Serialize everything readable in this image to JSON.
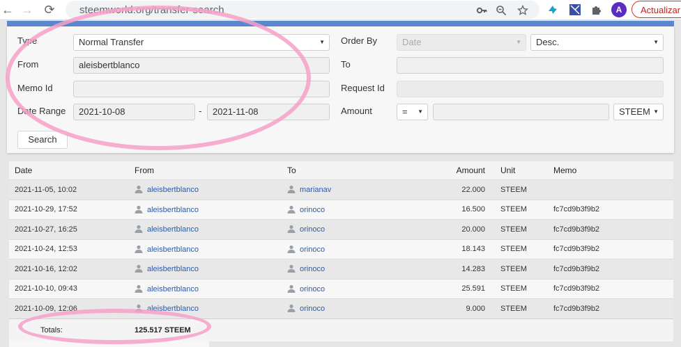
{
  "browser": {
    "url": "steemworld.org/transfer-search",
    "update_label": "Actualizar",
    "avatar_letter": "A",
    "back_glyph": "←",
    "forward_glyph": "→",
    "reload_glyph": "⟳"
  },
  "form": {
    "type_label": "Type",
    "type_value": "Normal Transfer",
    "from_label": "From",
    "from_value": "aleisbertblanco",
    "memo_id_label": "Memo Id",
    "memo_id_value": "",
    "date_range_label": "Date Range",
    "date_from": "2021-10-08",
    "date_separator": "-",
    "date_to": "2021-11-08",
    "order_by_label": "Order By",
    "order_by_value": "Date",
    "order_dir_value": "Desc.",
    "to_label": "To",
    "to_value": "",
    "request_id_label": "Request Id",
    "request_id_value": "",
    "amount_label": "Amount",
    "amount_op_value": "=",
    "amount_value": "",
    "currency_value": "STEEM",
    "search_label": "Search"
  },
  "table": {
    "columns": [
      "Date",
      "From",
      "To",
      "Amount",
      "Unit",
      "Memo"
    ],
    "rows": [
      {
        "date": "2021-11-05, 10:02",
        "from": "aleisbertblanco",
        "to": "marianav",
        "amount": "22.000",
        "unit": "STEEM",
        "memo": ""
      },
      {
        "date": "2021-10-29, 17:52",
        "from": "aleisbertblanco",
        "to": "orinoco",
        "amount": "16.500",
        "unit": "STEEM",
        "memo": "fc7cd9b3f9b2"
      },
      {
        "date": "2021-10-27, 16:25",
        "from": "aleisbertblanco",
        "to": "orinoco",
        "amount": "20.000",
        "unit": "STEEM",
        "memo": "fc7cd9b3f9b2"
      },
      {
        "date": "2021-10-24, 12:53",
        "from": "aleisbertblanco",
        "to": "orinoco",
        "amount": "18.143",
        "unit": "STEEM",
        "memo": "fc7cd9b3f9b2"
      },
      {
        "date": "2021-10-16, 12:02",
        "from": "aleisbertblanco",
        "to": "orinoco",
        "amount": "14.283",
        "unit": "STEEM",
        "memo": "fc7cd9b3f9b2"
      },
      {
        "date": "2021-10-10, 09:43",
        "from": "aleisbertblanco",
        "to": "orinoco",
        "amount": "25.591",
        "unit": "STEEM",
        "memo": "fc7cd9b3f9b2"
      },
      {
        "date": "2021-10-09, 12:06",
        "from": "aleisbertblanco",
        "to": "orinoco",
        "amount": "9.000",
        "unit": "STEEM",
        "memo": "fc7cd9b3f9b2"
      }
    ],
    "totals_label": "Totals:",
    "totals_value": "125.517 STEEM"
  },
  "colors": {
    "accent_bar": "#5a88cf",
    "link": "#2d5aa8",
    "annotation": "#f7a0c8"
  }
}
